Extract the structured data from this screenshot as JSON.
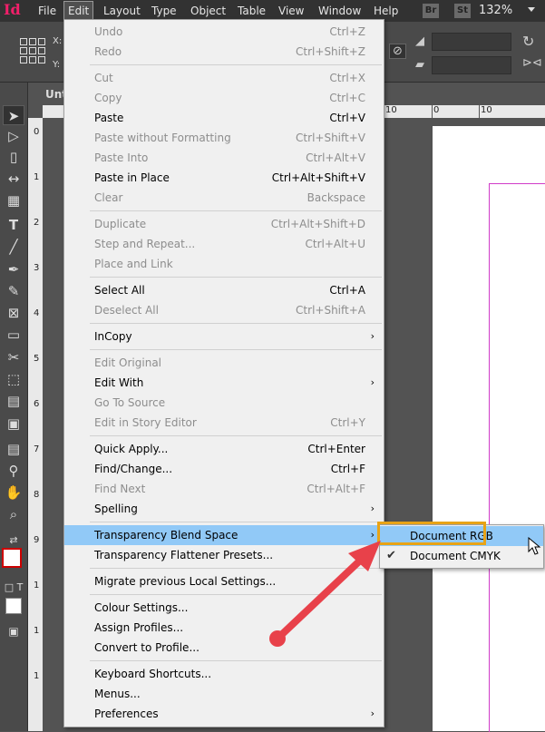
{
  "app": {
    "logo": "Id",
    "menubar": [
      "File",
      "Edit",
      "Layout",
      "Type",
      "Object",
      "Table",
      "View",
      "Window",
      "Help"
    ],
    "active_menu": "Edit",
    "badges": [
      "Br",
      "St"
    ],
    "zoom": "132%"
  },
  "control_bar": {
    "x_label": "X:",
    "y_label": "Y:"
  },
  "document": {
    "tab_title": "Unt",
    "ruler_h_labels": [
      "10",
      "10",
      "0",
      "10"
    ],
    "ruler_v_labels": [
      "0",
      "1\n0",
      "2\n0",
      "3\n0",
      "4\n0",
      "5\n0",
      "6\n0",
      "7\n0",
      "8\n0",
      "9\n0",
      "1\n0\n0"
    ]
  },
  "edit_menu": {
    "items": [
      {
        "label": "Undo",
        "shortcut": "Ctrl+Z",
        "disabled": true
      },
      {
        "label": "Redo",
        "shortcut": "Ctrl+Shift+Z",
        "disabled": true
      },
      {
        "label": "Cut",
        "shortcut": "Ctrl+X",
        "disabled": true
      },
      {
        "label": "Copy",
        "shortcut": "Ctrl+C",
        "disabled": true
      },
      {
        "label": "Paste",
        "shortcut": "Ctrl+V",
        "disabled": false
      },
      {
        "label": "Paste without Formatting",
        "shortcut": "Ctrl+Shift+V",
        "disabled": true
      },
      {
        "label": "Paste Into",
        "shortcut": "Ctrl+Alt+V",
        "disabled": true
      },
      {
        "label": "Paste in Place",
        "shortcut": "Ctrl+Alt+Shift+V",
        "disabled": false
      },
      {
        "label": "Clear",
        "shortcut": "Backspace",
        "disabled": true
      },
      {
        "label": "Duplicate",
        "shortcut": "Ctrl+Alt+Shift+D",
        "disabled": true
      },
      {
        "label": "Step and Repeat...",
        "shortcut": "Ctrl+Alt+U",
        "disabled": true
      },
      {
        "label": "Place and Link",
        "shortcut": "",
        "disabled": true
      },
      {
        "label": "Select All",
        "shortcut": "Ctrl+A",
        "disabled": false
      },
      {
        "label": "Deselect All",
        "shortcut": "Ctrl+Shift+A",
        "disabled": true
      },
      {
        "label": "InCopy",
        "shortcut": "",
        "disabled": false,
        "submenu": true
      },
      {
        "label": "Edit Original",
        "shortcut": "",
        "disabled": true
      },
      {
        "label": "Edit With",
        "shortcut": "",
        "disabled": false,
        "submenu": true
      },
      {
        "label": "Go To Source",
        "shortcut": "",
        "disabled": true
      },
      {
        "label": "Edit in Story Editor",
        "shortcut": "Ctrl+Y",
        "disabled": true
      },
      {
        "label": "Quick Apply...",
        "shortcut": "Ctrl+Enter",
        "disabled": false
      },
      {
        "label": "Find/Change...",
        "shortcut": "Ctrl+F",
        "disabled": false
      },
      {
        "label": "Find Next",
        "shortcut": "Ctrl+Alt+F",
        "disabled": true
      },
      {
        "label": "Spelling",
        "shortcut": "",
        "disabled": false,
        "submenu": true
      },
      {
        "label": "Transparency Blend Space",
        "shortcut": "",
        "disabled": false,
        "submenu": true,
        "highlighted": true
      },
      {
        "label": "Transparency Flattener Presets...",
        "shortcut": "",
        "disabled": false
      },
      {
        "label": "Migrate previous Local Settings...",
        "shortcut": "",
        "disabled": false
      },
      {
        "label": "Colour Settings...",
        "shortcut": "",
        "disabled": false
      },
      {
        "label": "Assign Profiles...",
        "shortcut": "",
        "disabled": false
      },
      {
        "label": "Convert to Profile...",
        "shortcut": "",
        "disabled": false
      },
      {
        "label": "Keyboard Shortcuts...",
        "shortcut": "",
        "disabled": false
      },
      {
        "label": "Menus...",
        "shortcut": "",
        "disabled": false
      },
      {
        "label": "Preferences",
        "shortcut": "",
        "disabled": false,
        "submenu": true
      }
    ]
  },
  "submenu": {
    "items": [
      {
        "label": "Document RGB",
        "checked": false,
        "highlighted": true
      },
      {
        "label": "Document CMYK",
        "checked": true,
        "highlighted": false
      }
    ]
  },
  "colors": {
    "menu_highlight": "#91c9f7",
    "callout_box": "#e8a316",
    "arrow": "#e8414a",
    "margin_guide": "#d03cc8"
  }
}
